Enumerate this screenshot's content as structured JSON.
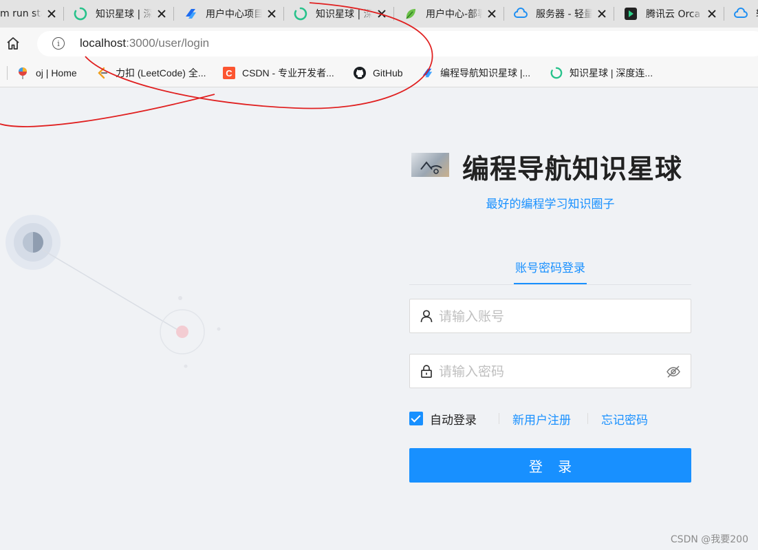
{
  "browser": {
    "tabs": [
      {
        "title": "m run sta",
        "icon": "page-icon"
      },
      {
        "title": "知识星球 | 深",
        "icon": "zsxq-spinner-icon"
      },
      {
        "title": "用户中心项目",
        "icon": "yupi-logo-icon"
      },
      {
        "title": "知识星球 | 深",
        "icon": "zsxq-spinner-icon"
      },
      {
        "title": "用户中心-部署",
        "icon": "leaf-icon"
      },
      {
        "title": "服务器 - 轻量",
        "icon": "tencent-cloud-icon"
      },
      {
        "title": "腾讯云 Orca",
        "icon": "orca-icon"
      },
      {
        "title": "轻",
        "icon": "tencent-cloud-icon"
      }
    ],
    "url_host": "localhost",
    "url_path": ":3000/user/login",
    "bookmarks": [
      {
        "label": "oj | Home",
        "icon": "balloon-icon"
      },
      {
        "label": "力扣 (LeetCode) 全...",
        "icon": "leetcode-icon"
      },
      {
        "label": "CSDN - 专业开发者...",
        "icon": "csdn-icon"
      },
      {
        "label": "GitHub",
        "icon": "github-icon"
      },
      {
        "label": "编程导航知识星球 |...",
        "icon": "yupi-logo-icon"
      },
      {
        "label": "知识星球 | 深度连...",
        "icon": "zsxq-spinner-icon"
      }
    ]
  },
  "login": {
    "title": "编程导航知识星球",
    "subtitle": "最好的编程学习知识圈子",
    "tab_label": "账号密码登录",
    "account_placeholder": "请输入账号",
    "password_placeholder": "请输入密码",
    "auto_login_label": "自动登录",
    "auto_login_checked": true,
    "register_link": "新用户注册",
    "forgot_link": "忘记密码",
    "submit_label": "登 录"
  },
  "colors": {
    "primary": "#1890ff",
    "background": "#f0f2f5",
    "annotation": "#e02020"
  },
  "watermark": "CSDN @我要200"
}
